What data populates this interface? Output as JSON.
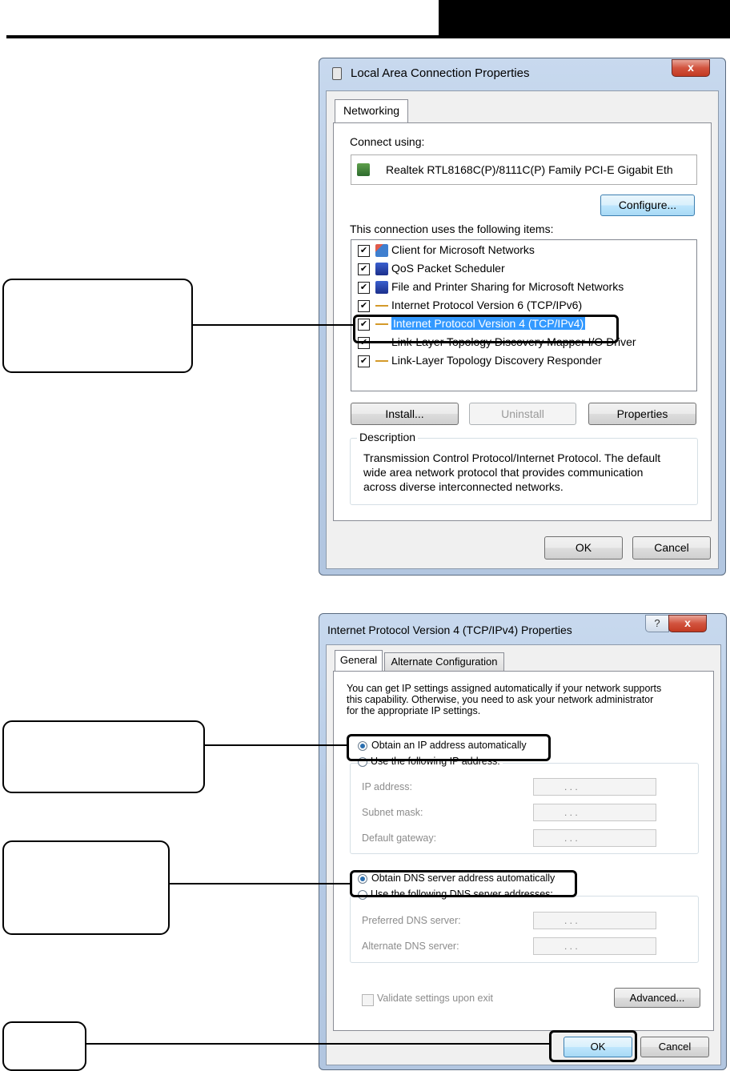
{
  "lan_dialog": {
    "title": "Local Area Connection Properties",
    "close_label": "x",
    "tab_networking": "Networking",
    "connect_using_label": "Connect using:",
    "adapter_name": "Realtek RTL8168C(P)/8111C(P) Family PCI-E Gigabit Eth",
    "configure_button": "Configure...",
    "items_label": "This connection uses the following items:",
    "items": [
      {
        "label": "Client for Microsoft Networks",
        "checked": true,
        "icon": "network-client-icon"
      },
      {
        "label": "QoS Packet Scheduler",
        "checked": true,
        "icon": "computer-icon"
      },
      {
        "label": "File and Printer Sharing for Microsoft Networks",
        "checked": true,
        "icon": "computer-icon"
      },
      {
        "label": "Internet Protocol Version 6 (TCP/IPv6)",
        "checked": true,
        "icon": "protocol-icon"
      },
      {
        "label": "Internet Protocol Version 4 (TCP/IPv4)",
        "checked": true,
        "icon": "protocol-icon",
        "selected": true
      },
      {
        "label": "Link-Layer Topology Discovery Mapper I/O Driver",
        "checked": true,
        "icon": "protocol-icon"
      },
      {
        "label": "Link-Layer Topology Discovery Responder",
        "checked": true,
        "icon": "protocol-icon"
      }
    ],
    "install_button": "Install...",
    "uninstall_button": "Uninstall",
    "properties_button": "Properties",
    "description_title": "Description",
    "description_line1": "Transmission Control Protocol/Internet Protocol. The default",
    "description_line2": "wide area network protocol that provides communication",
    "description_line3": "across diverse interconnected networks.",
    "ok_button": "OK",
    "cancel_button": "Cancel"
  },
  "ipv4_dialog": {
    "title": "Internet Protocol Version 4 (TCP/IPv4) Properties",
    "help_label": "?",
    "close_label": "x",
    "tab_general": "General",
    "tab_alternate": "Alternate Configuration",
    "intro_line1": "You can get IP settings assigned automatically if your network supports",
    "intro_line2": "this capability. Otherwise, you need to ask your network administrator",
    "intro_line3": "for the appropriate IP settings.",
    "obtain_ip_auto": "Obtain an IP address automatically",
    "use_following_ip": "Use the following IP address:",
    "ip_address_label": "IP address:",
    "subnet_mask_label": "Subnet mask:",
    "default_gateway_label": "Default gateway:",
    "obtain_dns_auto": "Obtain DNS server address automatically",
    "use_following_dns": "Use the following DNS server addresses:",
    "preferred_dns_label": "Preferred DNS server:",
    "alternate_dns_label": "Alternate DNS server:",
    "ip_placeholder": ".    .    .",
    "validate_label": "Validate settings upon exit",
    "advanced_button": "Advanced...",
    "ok_button": "OK",
    "cancel_button": "Cancel",
    "ip_mode": "automatic",
    "dns_mode": "automatic"
  },
  "colors": {
    "selection": "#3399ff",
    "window_frame": "#b6cbe6",
    "close_button": "#c33a22"
  }
}
